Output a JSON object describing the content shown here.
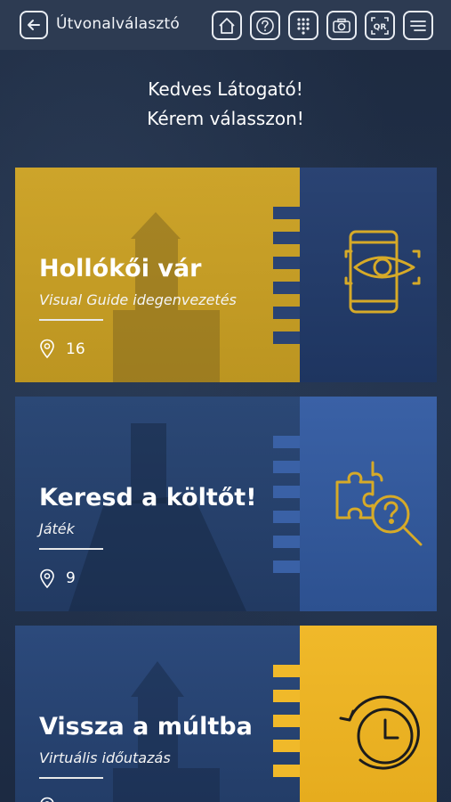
{
  "header": {
    "title": "Útvonalválasztó",
    "icons": [
      "back-arrow-icon",
      "home-icon",
      "help-icon",
      "keypad-icon",
      "camera-icon",
      "qr-icon",
      "menu-icon"
    ]
  },
  "greeting": {
    "line1": "Kedves Látogató!",
    "line2": "Kérem válasszon!"
  },
  "routes": [
    {
      "title": "Hollókői vár",
      "subtitle": "Visual Guide idegenvezetés",
      "stops": "16",
      "icon": "phone-eye-icon",
      "accent": "#d6aa28"
    },
    {
      "title": "Keresd a költőt!",
      "subtitle": "Játék",
      "stops": "9",
      "icon": "puzzle-search-icon",
      "accent": "#3a61a6"
    },
    {
      "title": "Vissza a múltba",
      "subtitle": "Virtuális időutazás",
      "stops": "",
      "icon": "history-clock-icon",
      "accent": "#f0b92a"
    }
  ],
  "colors": {
    "topbar": "#2d3b52",
    "background": "#1f2e47",
    "gold": "#d6aa28",
    "blue": "#2a4373"
  }
}
